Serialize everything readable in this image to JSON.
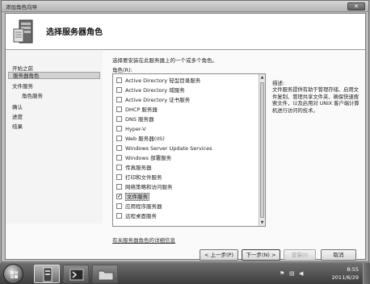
{
  "window": {
    "title": "添加角色向导",
    "close_glyph": "✕"
  },
  "header": {
    "title": "选择服务器角色"
  },
  "nav": {
    "items": [
      {
        "label": "开始之前"
      },
      {
        "label": "服务器角色"
      },
      {
        "label": "文件服务"
      },
      {
        "label": "角色服务"
      },
      {
        "label": "确认"
      },
      {
        "label": "进度"
      },
      {
        "label": "结果"
      }
    ]
  },
  "main": {
    "instruction": "选择要安装在此服务器上的一个或多个角色。",
    "roles_label": "角色(R):",
    "roles": [
      {
        "label": "Active Directory 轻型目录服务",
        "checked": false
      },
      {
        "label": "Active Directory 域服务",
        "checked": false
      },
      {
        "label": "Active Directory 证书服务",
        "checked": false
      },
      {
        "label": "DHCP 服务器",
        "checked": false
      },
      {
        "label": "DNS 服务器",
        "checked": false
      },
      {
        "label": "Hyper-V",
        "checked": false
      },
      {
        "label": "Web 服务器(IIS)",
        "checked": false
      },
      {
        "label": "Windows Server Update Services",
        "checked": false
      },
      {
        "label": "Windows 部署服务",
        "checked": false
      },
      {
        "label": "传真服务器",
        "checked": false
      },
      {
        "label": "打印和文件服务",
        "checked": false
      },
      {
        "label": "网络策略和访问服务",
        "checked": false
      },
      {
        "label": "文件服务",
        "checked": true
      },
      {
        "label": "应用程序服务器",
        "checked": false
      },
      {
        "label": "远程桌面服务",
        "checked": false
      }
    ],
    "check_glyph": "✓",
    "description_title": "描述:",
    "description": "文件服务提供有助于管理存储、启用文件复制、管理共享文件夹、确保快速搜索文件，以及启用对 UNIX 客户端计算机进行访问的技术。",
    "more_link": "有关服务器角色的详细信息"
  },
  "buttons": {
    "prev": "< 上一步(P)",
    "next": "下一步(N) >",
    "install": "安装(I)",
    "cancel": "取消"
  },
  "taskbar": {
    "time": "8:55",
    "date": "2011/6/29",
    "tray_flag": "⚑",
    "tray_network": "▤",
    "tray_volume": "◀"
  }
}
